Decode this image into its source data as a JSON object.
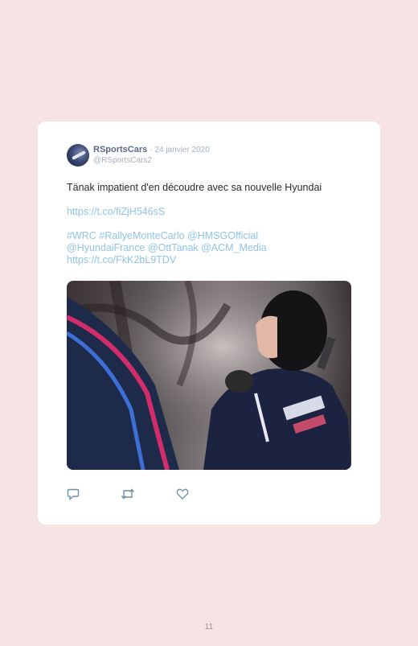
{
  "tweet": {
    "display_name": "RSportsCars",
    "date": "· 24 janvier 2020",
    "handle": "@RSportsCars2",
    "text": "Tänak impatient d'en découdre avec sa nouvelle Hyundai",
    "link1": "https://t.co/fiZjH546sS",
    "hashtags_line1": "#WRC #RallyeMonteCarlo @HMSGOfficial",
    "hashtags_line2": "@HyundaiFrance @OttTanak @ACM_Media",
    "link2": "https://t.co/FkK2bL9TDV"
  },
  "actions": {
    "reply_icon": "reply-icon",
    "retweet_icon": "retweet-icon",
    "like_icon": "like-icon"
  },
  "colors": {
    "page_background": "#f6e4e5",
    "link": "#8fc4e8",
    "name": "#586a88",
    "meta": "#a4b2c6",
    "icon": "#6f8fa6"
  },
  "page": {
    "number": "11"
  }
}
